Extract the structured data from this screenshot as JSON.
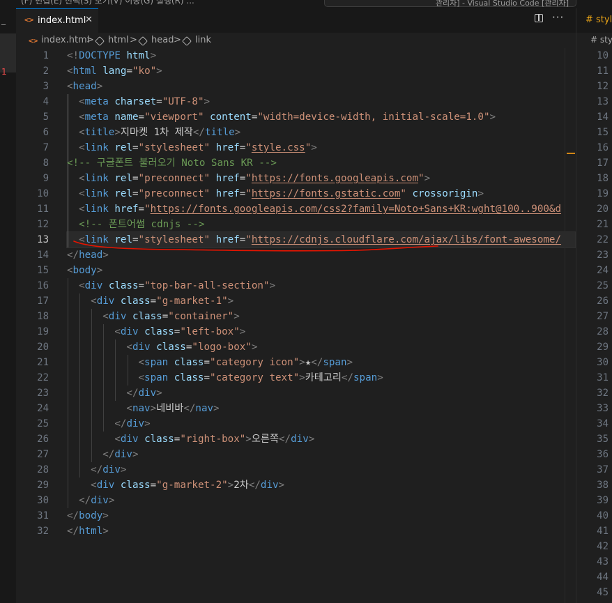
{
  "menu": {
    "text": "(F)  편집(E)  선택(S)  보기(V)  이동(G)  실행(R)  ...",
    "search_text": "관리자] - Visual Studio Code [관리자]"
  },
  "activity": {
    "dash": "─",
    "problem_marker": "1"
  },
  "tab": {
    "icon": "<>",
    "label": "index.html",
    "close": "✕"
  },
  "toolbar": {
    "more": "···"
  },
  "breadcrumb": {
    "file": "index.html",
    "items": [
      "html",
      "head",
      "link"
    ],
    "separator": ">"
  },
  "editor": {
    "active_line": 13,
    "line_numbers": [
      "1",
      "2",
      "3",
      "4",
      "5",
      "6",
      "7",
      "8",
      "9",
      "10",
      "11",
      "12",
      "13",
      "14",
      "15",
      "16",
      "17",
      "18",
      "19",
      "20",
      "21",
      "22",
      "23",
      "24",
      "25",
      "26",
      "27",
      "28",
      "29",
      "30",
      "31",
      "32"
    ],
    "lines": [
      [
        [
          "t",
          "<!"
        ],
        [
          "n",
          "DOCTYPE"
        ],
        [
          "e",
          " "
        ],
        [
          "a",
          "html"
        ],
        [
          "t",
          ">"
        ]
      ],
      [
        [
          "t",
          "<"
        ],
        [
          "n",
          "html"
        ],
        [
          "e",
          " "
        ],
        [
          "a",
          "lang"
        ],
        [
          "e",
          "="
        ],
        [
          "s",
          "\"ko\""
        ],
        [
          "t",
          ">"
        ]
      ],
      [
        [
          "t",
          "<"
        ],
        [
          "n",
          "head"
        ],
        [
          "t",
          ">"
        ]
      ],
      [
        [
          "e",
          "  "
        ],
        [
          "t",
          "<"
        ],
        [
          "n",
          "meta"
        ],
        [
          "e",
          " "
        ],
        [
          "a",
          "charset"
        ],
        [
          "e",
          "="
        ],
        [
          "s",
          "\"UTF-8\""
        ],
        [
          "t",
          ">"
        ]
      ],
      [
        [
          "e",
          "  "
        ],
        [
          "t",
          "<"
        ],
        [
          "n",
          "meta"
        ],
        [
          "e",
          " "
        ],
        [
          "a",
          "name"
        ],
        [
          "e",
          "="
        ],
        [
          "s",
          "\"viewport\""
        ],
        [
          "e",
          " "
        ],
        [
          "a",
          "content"
        ],
        [
          "e",
          "="
        ],
        [
          "s",
          "\"width=device-width, initial-scale=1.0\""
        ],
        [
          "t",
          ">"
        ]
      ],
      [
        [
          "e",
          "  "
        ],
        [
          "t",
          "<"
        ],
        [
          "n",
          "title"
        ],
        [
          "t",
          ">"
        ],
        [
          "x",
          "지마켓 1차 제작"
        ],
        [
          "t",
          "</"
        ],
        [
          "n",
          "title"
        ],
        [
          "t",
          ">"
        ]
      ],
      [
        [
          "e",
          "  "
        ],
        [
          "t",
          "<"
        ],
        [
          "n",
          "link"
        ],
        [
          "e",
          " "
        ],
        [
          "a",
          "rel"
        ],
        [
          "e",
          "="
        ],
        [
          "s",
          "\"stylesheet\""
        ],
        [
          "e",
          " "
        ],
        [
          "a",
          "href"
        ],
        [
          "e",
          "="
        ],
        [
          "s",
          "\""
        ],
        [
          "u",
          "style.css"
        ],
        [
          "s",
          "\""
        ],
        [
          "t",
          ">"
        ]
      ],
      [
        [
          "c",
          "<!-- 구글폰트 불러오기 Noto Sans KR -->"
        ]
      ],
      [
        [
          "e",
          "  "
        ],
        [
          "t",
          "<"
        ],
        [
          "n",
          "link"
        ],
        [
          "e",
          " "
        ],
        [
          "a",
          "rel"
        ],
        [
          "e",
          "="
        ],
        [
          "s",
          "\"preconnect\""
        ],
        [
          "e",
          " "
        ],
        [
          "a",
          "href"
        ],
        [
          "e",
          "="
        ],
        [
          "s",
          "\""
        ],
        [
          "u",
          "https://fonts.googleapis.com"
        ],
        [
          "s",
          "\""
        ],
        [
          "t",
          ">"
        ]
      ],
      [
        [
          "e",
          "  "
        ],
        [
          "t",
          "<"
        ],
        [
          "n",
          "link"
        ],
        [
          "e",
          " "
        ],
        [
          "a",
          "rel"
        ],
        [
          "e",
          "="
        ],
        [
          "s",
          "\"preconnect\""
        ],
        [
          "e",
          " "
        ],
        [
          "a",
          "href"
        ],
        [
          "e",
          "="
        ],
        [
          "s",
          "\""
        ],
        [
          "u",
          "https://fonts.gstatic.com"
        ],
        [
          "s",
          "\""
        ],
        [
          "e",
          " "
        ],
        [
          "a",
          "crossorigin"
        ],
        [
          "t",
          ">"
        ]
      ],
      [
        [
          "e",
          "  "
        ],
        [
          "t",
          "<"
        ],
        [
          "n",
          "link"
        ],
        [
          "e",
          " "
        ],
        [
          "a",
          "href"
        ],
        [
          "e",
          "="
        ],
        [
          "s",
          "\""
        ],
        [
          "u",
          "https://fonts.googleapis.com/css2?family=Noto+Sans+KR:wght@100..900&d"
        ]
      ],
      [
        [
          "e",
          "  "
        ],
        [
          "c",
          "<!-- 폰트어썸 cdnjs -->"
        ]
      ],
      [
        [
          "e",
          "  "
        ],
        [
          "t",
          "<"
        ],
        [
          "n",
          "link"
        ],
        [
          "e",
          " "
        ],
        [
          "a",
          "rel"
        ],
        [
          "e",
          "="
        ],
        [
          "s",
          "\"stylesheet\""
        ],
        [
          "e",
          " "
        ],
        [
          "a",
          "href"
        ],
        [
          "e",
          "="
        ],
        [
          "s",
          "\""
        ],
        [
          "u",
          "https://cdnjs.cloudflare.com/ajax/libs/font-awesome/"
        ]
      ],
      [
        [
          "t",
          "</"
        ],
        [
          "n",
          "head"
        ],
        [
          "t",
          ">"
        ]
      ],
      [
        [
          "t",
          "<"
        ],
        [
          "n",
          "body"
        ],
        [
          "t",
          ">"
        ]
      ],
      [
        [
          "e",
          "  "
        ],
        [
          "t",
          "<"
        ],
        [
          "n",
          "div"
        ],
        [
          "e",
          " "
        ],
        [
          "a",
          "class"
        ],
        [
          "e",
          "="
        ],
        [
          "s",
          "\"top-bar-all-section\""
        ],
        [
          "t",
          ">"
        ]
      ],
      [
        [
          "e",
          "    "
        ],
        [
          "t",
          "<"
        ],
        [
          "n",
          "div"
        ],
        [
          "e",
          " "
        ],
        [
          "a",
          "class"
        ],
        [
          "e",
          "="
        ],
        [
          "s",
          "\"g-market-1\""
        ],
        [
          "t",
          ">"
        ]
      ],
      [
        [
          "e",
          "      "
        ],
        [
          "t",
          "<"
        ],
        [
          "n",
          "div"
        ],
        [
          "e",
          " "
        ],
        [
          "a",
          "class"
        ],
        [
          "e",
          "="
        ],
        [
          "s",
          "\"container\""
        ],
        [
          "t",
          ">"
        ]
      ],
      [
        [
          "e",
          "        "
        ],
        [
          "t",
          "<"
        ],
        [
          "n",
          "div"
        ],
        [
          "e",
          " "
        ],
        [
          "a",
          "class"
        ],
        [
          "e",
          "="
        ],
        [
          "s",
          "\"left-box\""
        ],
        [
          "t",
          ">"
        ]
      ],
      [
        [
          "e",
          "          "
        ],
        [
          "t",
          "<"
        ],
        [
          "n",
          "div"
        ],
        [
          "e",
          " "
        ],
        [
          "a",
          "class"
        ],
        [
          "e",
          "="
        ],
        [
          "s",
          "\"logo-box\""
        ],
        [
          "t",
          ">"
        ]
      ],
      [
        [
          "e",
          "            "
        ],
        [
          "t",
          "<"
        ],
        [
          "n",
          "span"
        ],
        [
          "e",
          " "
        ],
        [
          "a",
          "class"
        ],
        [
          "e",
          "="
        ],
        [
          "s",
          "\"category icon\""
        ],
        [
          "t",
          ">"
        ],
        [
          "x",
          "★"
        ],
        [
          "t",
          "</"
        ],
        [
          "n",
          "span"
        ],
        [
          "t",
          ">"
        ]
      ],
      [
        [
          "e",
          "            "
        ],
        [
          "t",
          "<"
        ],
        [
          "n",
          "span"
        ],
        [
          "e",
          " "
        ],
        [
          "a",
          "class"
        ],
        [
          "e",
          "="
        ],
        [
          "s",
          "\"category text\""
        ],
        [
          "t",
          ">"
        ],
        [
          "x",
          "카테고리"
        ],
        [
          "t",
          "</"
        ],
        [
          "n",
          "span"
        ],
        [
          "t",
          ">"
        ]
      ],
      [
        [
          "e",
          "          "
        ],
        [
          "t",
          "</"
        ],
        [
          "n",
          "div"
        ],
        [
          "t",
          ">"
        ]
      ],
      [
        [
          "e",
          "          "
        ],
        [
          "t",
          "<"
        ],
        [
          "n",
          "nav"
        ],
        [
          "t",
          ">"
        ],
        [
          "x",
          "네비바"
        ],
        [
          "t",
          "</"
        ],
        [
          "n",
          "nav"
        ],
        [
          "t",
          ">"
        ]
      ],
      [
        [
          "e",
          "        "
        ],
        [
          "t",
          "</"
        ],
        [
          "n",
          "div"
        ],
        [
          "t",
          ">"
        ]
      ],
      [
        [
          "e",
          "        "
        ],
        [
          "t",
          "<"
        ],
        [
          "n",
          "div"
        ],
        [
          "e",
          " "
        ],
        [
          "a",
          "class"
        ],
        [
          "e",
          "="
        ],
        [
          "s",
          "\"right-box\""
        ],
        [
          "t",
          ">"
        ],
        [
          "x",
          "오른쪽"
        ],
        [
          "t",
          "</"
        ],
        [
          "n",
          "div"
        ],
        [
          "t",
          ">"
        ]
      ],
      [
        [
          "e",
          "      "
        ],
        [
          "t",
          "</"
        ],
        [
          "n",
          "div"
        ],
        [
          "t",
          ">"
        ]
      ],
      [
        [
          "e",
          "    "
        ],
        [
          "t",
          "</"
        ],
        [
          "n",
          "div"
        ],
        [
          "t",
          ">"
        ]
      ],
      [
        [
          "e",
          "    "
        ],
        [
          "t",
          "<"
        ],
        [
          "n",
          "div"
        ],
        [
          "e",
          " "
        ],
        [
          "a",
          "class"
        ],
        [
          "e",
          "="
        ],
        [
          "s",
          "\"g-market-2\""
        ],
        [
          "t",
          ">"
        ],
        [
          "x",
          "2차"
        ],
        [
          "t",
          "</"
        ],
        [
          "n",
          "div"
        ],
        [
          "t",
          ">"
        ]
      ],
      [
        [
          "e",
          "  "
        ],
        [
          "t",
          "</"
        ],
        [
          "n",
          "div"
        ],
        [
          "t",
          ">"
        ]
      ],
      [
        [
          "t",
          "</"
        ],
        [
          "n",
          "body"
        ],
        [
          "t",
          ">"
        ]
      ],
      [
        [
          "t",
          "</"
        ],
        [
          "n",
          "html"
        ],
        [
          "t",
          ">"
        ]
      ]
    ]
  },
  "right_pane": {
    "tab_label": "# style",
    "breadcrumb": "# sty",
    "line_numbers": [
      "10",
      "11",
      "12",
      "13",
      "14",
      "15",
      "16",
      "17",
      "18",
      "19",
      "20",
      "21",
      "22",
      "23",
      "24",
      "25",
      "26",
      "27",
      "28",
      "29",
      "30",
      "31",
      "32",
      "33",
      "34",
      "35",
      "36",
      "37",
      "38",
      "39",
      "40",
      "41",
      "42",
      "43",
      "44",
      "45"
    ]
  },
  "colors": {
    "tag_punct": "#808080",
    "tag_name": "#569cd6",
    "attr": "#9cdcfe",
    "string": "#ce9178",
    "comment": "#6a9955",
    "annotation_red": "#e51400"
  }
}
